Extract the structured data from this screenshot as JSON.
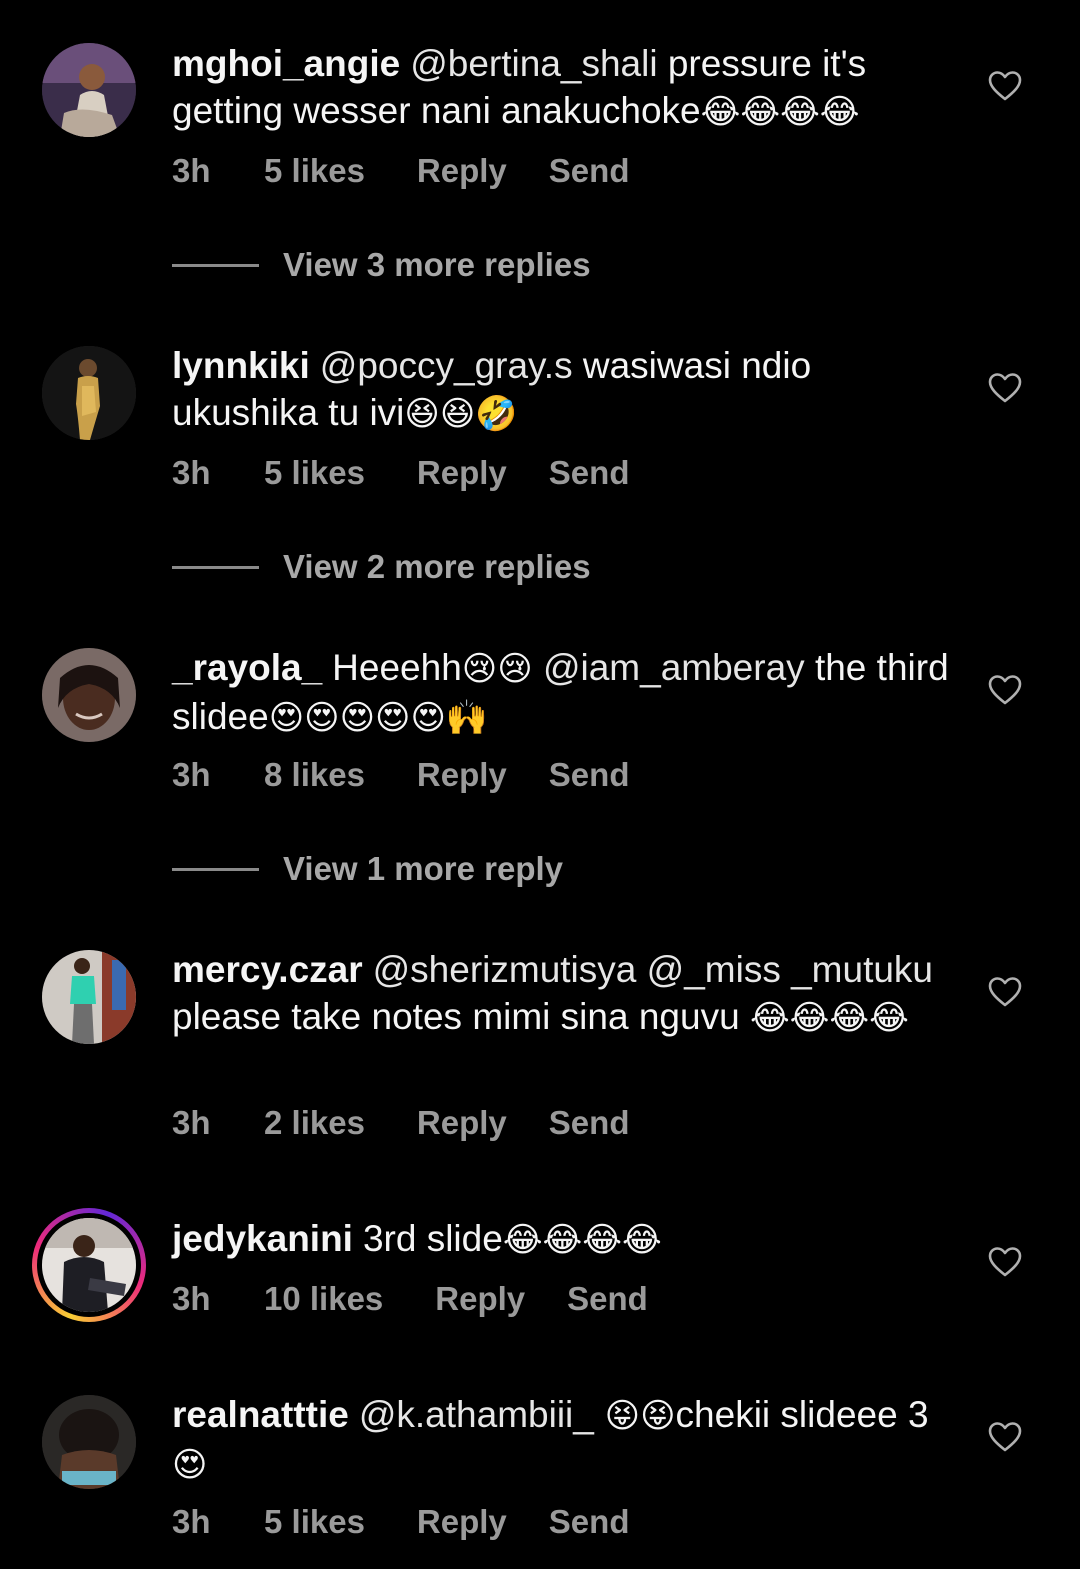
{
  "comments": [
    {
      "username": "mghoi_angie",
      "mention": "@bertina_shali",
      "text": " pressure it's getting wesser nani anakuchoke",
      "emojis": "😂😂😂😂",
      "time": "3h",
      "likes": "5 likes",
      "reply": "Reply",
      "send": "Send",
      "view_replies": "View 3 more replies"
    },
    {
      "username": "lynnkiki",
      "mention": "@poccy_gray.s",
      "text": " wasiwasi ndio ukushika tu ivi",
      "emojis": "😆😆🤣",
      "time": "3h",
      "likes": "5 likes",
      "reply": "Reply",
      "send": "Send",
      "view_replies": "View 2 more replies"
    },
    {
      "username": "_rayola_",
      "text_before": "Heeehh",
      "emojis_a": "😢😢",
      "mention": " @iam_amberay",
      "text": "  the third slidee",
      "emojis": "😍😍😍😍😍🙌",
      "time": "3h",
      "likes": "8 likes",
      "reply": "Reply",
      "send": "Send",
      "view_replies": "View 1 more reply"
    },
    {
      "username": "mercy.czar",
      "mention": "@sherizmutisya @_miss _mutuku",
      "text": " please take notes mimi sina nguvu",
      "emojis": "😂😂😂😂",
      "time": "3h",
      "likes": "2 likes",
      "reply": "Reply",
      "send": "Send"
    },
    {
      "username": "jedykanini",
      "text": "3rd slide",
      "emojis": "😂😂😂😂",
      "time": "3h",
      "likes": "10 likes",
      "reply": "Reply",
      "send": "Send"
    },
    {
      "username": "realnatttie",
      "mention": "@k.athambiii_",
      "emojis_a": " 😝😝",
      "text": "chekii slideee 3",
      "emojis": "😍",
      "time": "3h",
      "likes": "5 likes",
      "reply": "Reply",
      "send": "Send"
    }
  ],
  "icons": {
    "like": "heart-outline-icon"
  },
  "colors": {
    "background": "#000000",
    "text": "#f5f5f5",
    "meta": "#9a9a9a",
    "story_ring": [
      "#f9ce34",
      "#ee2a7b",
      "#6228d7"
    ]
  }
}
